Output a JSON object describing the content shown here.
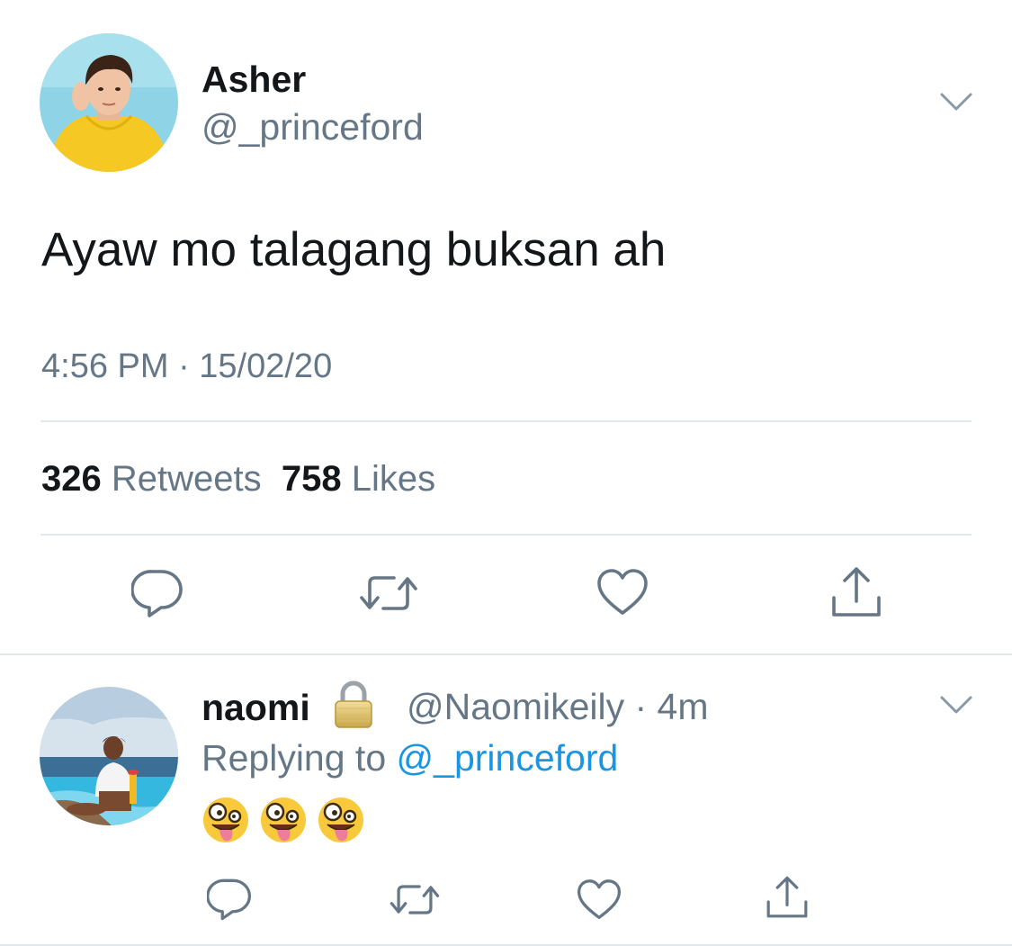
{
  "tweet": {
    "author_name": "Asher",
    "author_handle": "@_princeford",
    "text": "Ayaw mo talagang buksan ah",
    "timestamp": "4:56 PM · 15/02/20",
    "retweet_count": "326",
    "retweet_label": "Retweets",
    "like_count": "758",
    "like_label": "Likes",
    "actions": [
      "reply-icon",
      "retweet-icon",
      "like-icon",
      "share-icon"
    ]
  },
  "reply": {
    "author_name": "naomi",
    "lock_icon": "lock-icon",
    "handle_time": "@Naomikeily · 4m",
    "replying_prefix": "Replying to",
    "replying_mention": "@_princeford",
    "emojis": [
      "zany-face-emoji",
      "zany-face-emoji",
      "zany-face-emoji"
    ],
    "actions": [
      "reply-icon",
      "retweet-icon",
      "like-icon",
      "share-icon"
    ]
  },
  "colors": {
    "primary_text": "#14171a",
    "secondary_text": "#657786",
    "link": "#1b95e0",
    "divider": "#e1e8ed",
    "icon": "#657786"
  }
}
